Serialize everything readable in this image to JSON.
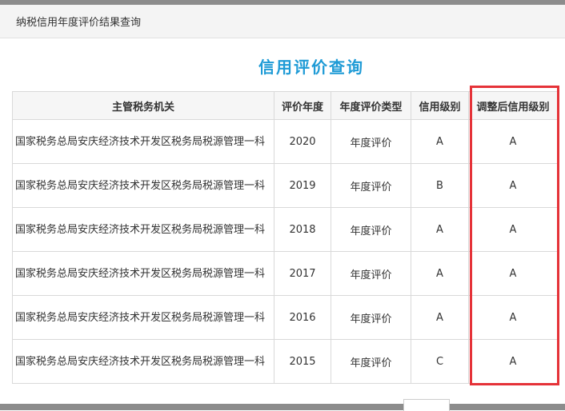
{
  "header": {
    "title": "纳税信用年度评价结果查询"
  },
  "page": {
    "title": "信用评价查询"
  },
  "table": {
    "columns": [
      "主管税务机关",
      "评价年度",
      "年度评价类型",
      "信用级别",
      "调整后信用级别"
    ],
    "rows": [
      {
        "org": "国家税务总局安庆经济技术开发区税务局税源管理一科",
        "year": "2020",
        "type": "年度评价",
        "level": "A",
        "adjusted": "A"
      },
      {
        "org": "国家税务总局安庆经济技术开发区税务局税源管理一科",
        "year": "2019",
        "type": "年度评价",
        "level": "B",
        "adjusted": "A"
      },
      {
        "org": "国家税务总局安庆经济技术开发区税务局税源管理一科",
        "year": "2018",
        "type": "年度评价",
        "level": "A",
        "adjusted": "A"
      },
      {
        "org": "国家税务总局安庆经济技术开发区税务局税源管理一科",
        "year": "2017",
        "type": "年度评价",
        "level": "A",
        "adjusted": "A"
      },
      {
        "org": "国家税务总局安庆经济技术开发区税务局税源管理一科",
        "year": "2016",
        "type": "年度评价",
        "level": "A",
        "adjusted": "A"
      },
      {
        "org": "国家税务总局安庆经济技术开发区税务局税源管理一科",
        "year": "2015",
        "type": "年度评价",
        "level": "C",
        "adjusted": "A"
      }
    ]
  },
  "colors": {
    "title": "#1f9bd6",
    "highlight": "#e53238"
  }
}
